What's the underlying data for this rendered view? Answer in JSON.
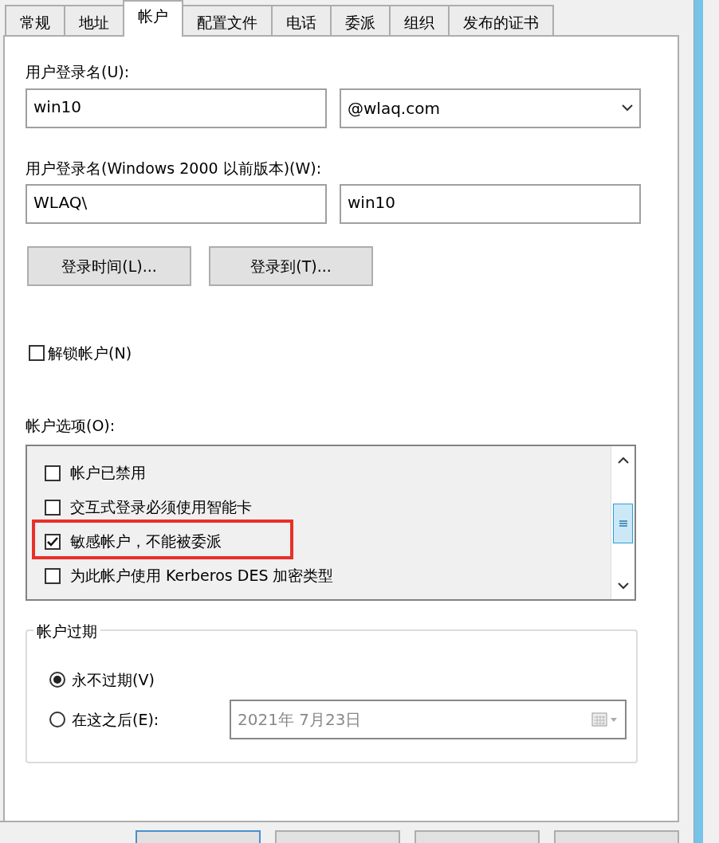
{
  "tabs": [
    {
      "label": "常规",
      "selected": false
    },
    {
      "label": "地址",
      "selected": false
    },
    {
      "label": "帐户",
      "selected": true
    },
    {
      "label": "配置文件",
      "selected": false
    },
    {
      "label": "电话",
      "selected": false
    },
    {
      "label": "委派",
      "selected": false
    },
    {
      "label": "组织",
      "selected": false
    },
    {
      "label": "发布的证书",
      "selected": false
    }
  ],
  "logon_name": {
    "label": "用户登录名(U):",
    "value": "win10",
    "domain": "@wlaq.com"
  },
  "legacy_logon_name": {
    "label": "用户登录名(Windows 2000 以前版本)(W):",
    "domain": "WLAQ\\",
    "value": "win10"
  },
  "buttons": [
    "登录时间(L)...",
    "登录到(T)..."
  ],
  "unlock": {
    "label": "解锁帐户(N)",
    "checked": false
  },
  "options": {
    "label": "帐户选项(O):",
    "items": [
      {
        "label": "帐户已禁用",
        "checked": false,
        "highlight": false
      },
      {
        "label": "交互式登录必须使用智能卡",
        "checked": false,
        "highlight": false
      },
      {
        "label": "敏感帐户，不能被委派",
        "checked": true,
        "highlight": true
      },
      {
        "label": "为此帐户使用 Kerberos DES 加密类型",
        "checked": false,
        "highlight": false
      }
    ]
  },
  "expiry": {
    "title": "帐户过期",
    "options": [
      {
        "label": "永不过期(V)",
        "selected": true
      },
      {
        "label": "在这之后(E):",
        "selected": false
      }
    ],
    "date": "2021年  7月23日"
  },
  "bottom_buttons": [
    {
      "kind": "button"
    },
    {
      "kind": "button"
    },
    {
      "kind": "button"
    },
    {
      "kind": "button"
    }
  ]
}
